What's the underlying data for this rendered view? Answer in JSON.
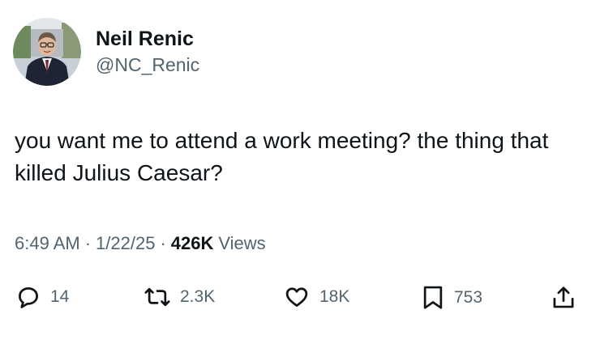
{
  "author": {
    "display_name": "Neil Renic",
    "handle": "@NC_Renic",
    "avatar_icon": "profile-photo"
  },
  "tweet": {
    "text": "you want me to attend a work meeting? the thing that killed Julius Caesar?",
    "time": "6:49 AM",
    "separator": "·",
    "date": "1/22/25",
    "views_count": "426K",
    "views_label": "Views"
  },
  "actions": {
    "replies": "14",
    "reposts": "2.3K",
    "likes": "18K",
    "bookmarks": "753"
  },
  "colors": {
    "text": "#0f1419",
    "secondary": "#536471",
    "background": "#ffffff"
  }
}
